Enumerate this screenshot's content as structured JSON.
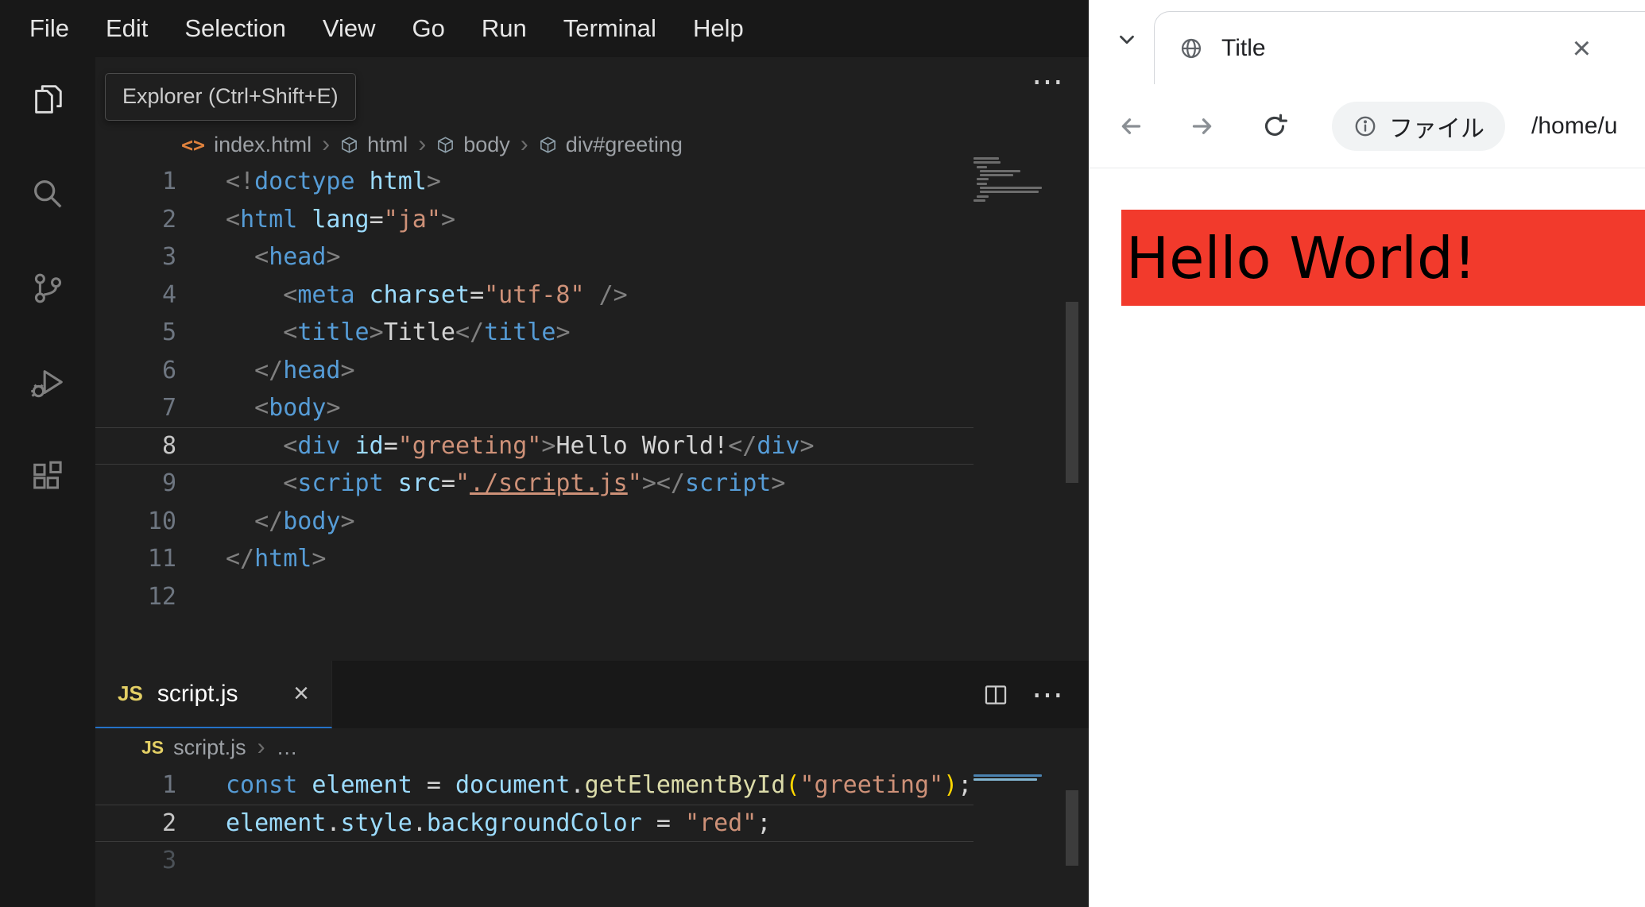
{
  "vscode": {
    "menu_items": [
      "File",
      "Edit",
      "Selection",
      "View",
      "Go",
      "Run",
      "Terminal",
      "Help"
    ],
    "activity_tooltip": "Explorer (Ctrl+Shift+E)",
    "editor_actions_more": "⋯",
    "breadcrumb": {
      "file": "index.html",
      "sep": "›",
      "segments": [
        "html",
        "body",
        "div#greeting"
      ]
    },
    "html_code": {
      "lines": [
        {
          "n": 1,
          "t": [
            [
              "pun",
              "<!"
            ],
            [
              "tag",
              "doctype"
            ],
            [
              "plain",
              " "
            ],
            [
              "attr",
              "html"
            ],
            [
              "pun",
              ">"
            ]
          ]
        },
        {
          "n": 2,
          "t": [
            [
              "pun",
              "<"
            ],
            [
              "tag",
              "html"
            ],
            [
              "plain",
              " "
            ],
            [
              "attr",
              "lang"
            ],
            [
              "plain",
              "="
            ],
            [
              "str",
              "\"ja\""
            ],
            [
              "pun",
              ">"
            ]
          ]
        },
        {
          "n": 3,
          "t": [
            [
              "plain",
              "  "
            ],
            [
              "pun",
              "<"
            ],
            [
              "tag",
              "head"
            ],
            [
              "pun",
              ">"
            ]
          ]
        },
        {
          "n": 4,
          "t": [
            [
              "plain",
              "    "
            ],
            [
              "pun",
              "<"
            ],
            [
              "tag",
              "meta"
            ],
            [
              "plain",
              " "
            ],
            [
              "attr",
              "charset"
            ],
            [
              "plain",
              "="
            ],
            [
              "str",
              "\"utf-8\""
            ],
            [
              "plain",
              " "
            ],
            [
              "pun",
              "/>"
            ]
          ]
        },
        {
          "n": 5,
          "t": [
            [
              "plain",
              "    "
            ],
            [
              "pun",
              "<"
            ],
            [
              "tag",
              "title"
            ],
            [
              "pun",
              ">"
            ],
            [
              "txt",
              "Title"
            ],
            [
              "pun",
              "</"
            ],
            [
              "tag",
              "title"
            ],
            [
              "pun",
              ">"
            ]
          ]
        },
        {
          "n": 6,
          "t": [
            [
              "plain",
              "  "
            ],
            [
              "pun",
              "</"
            ],
            [
              "tag",
              "head"
            ],
            [
              "pun",
              ">"
            ]
          ]
        },
        {
          "n": 7,
          "t": [
            [
              "plain",
              "  "
            ],
            [
              "pun",
              "<"
            ],
            [
              "tag",
              "body"
            ],
            [
              "pun",
              ">"
            ]
          ]
        },
        {
          "n": 8,
          "cur": true,
          "t": [
            [
              "plain",
              "    "
            ],
            [
              "pun",
              "<"
            ],
            [
              "tag",
              "div"
            ],
            [
              "plain",
              " "
            ],
            [
              "attr",
              "id"
            ],
            [
              "plain",
              "="
            ],
            [
              "str",
              "\"greeting\""
            ],
            [
              "pun",
              ">"
            ],
            [
              "txt",
              "Hello World!"
            ],
            [
              "pun",
              "</"
            ],
            [
              "tag",
              "div"
            ],
            [
              "pun",
              ">"
            ]
          ]
        },
        {
          "n": 9,
          "t": [
            [
              "plain",
              "    "
            ],
            [
              "pun",
              "<"
            ],
            [
              "tag",
              "script"
            ],
            [
              "plain",
              " "
            ],
            [
              "attr",
              "src"
            ],
            [
              "plain",
              "="
            ],
            [
              "str",
              "\""
            ],
            [
              "link",
              "./script.js"
            ],
            [
              "str",
              "\""
            ],
            [
              "pun",
              ">"
            ],
            [
              "pun",
              "</"
            ],
            [
              "tag",
              "script"
            ],
            [
              "pun",
              ">"
            ]
          ]
        },
        {
          "n": 10,
          "t": [
            [
              "plain",
              "  "
            ],
            [
              "pun",
              "</"
            ],
            [
              "tag",
              "body"
            ],
            [
              "pun",
              ">"
            ]
          ]
        },
        {
          "n": 11,
          "t": [
            [
              "pun",
              "</"
            ],
            [
              "tag",
              "html"
            ],
            [
              "pun",
              ">"
            ]
          ]
        },
        {
          "n": 12,
          "t": []
        }
      ]
    },
    "panel": {
      "tab_icon": "JS",
      "tab_label": "script.js",
      "close_label": "×",
      "actions_more": "⋯",
      "breadcrumb_file": "script.js",
      "breadcrumb_sep": "›",
      "breadcrumb_more": "…",
      "js_code": {
        "lines": [
          {
            "n": 1,
            "t": [
              [
                "kw",
                "const"
              ],
              [
                "plain",
                " "
              ],
              [
                "var",
                "element"
              ],
              [
                "plain",
                " = "
              ],
              [
                "var",
                "document"
              ],
              [
                "plain",
                "."
              ],
              [
                "fn",
                "getElementById"
              ],
              [
                "brk",
                "("
              ],
              [
                "str",
                "\"greeting\""
              ],
              [
                "brk",
                ")"
              ],
              [
                "plain",
                ";"
              ]
            ]
          },
          {
            "n": 2,
            "cur": true,
            "t": [
              [
                "var",
                "element"
              ],
              [
                "plain",
                "."
              ],
              [
                "var",
                "style"
              ],
              [
                "plain",
                "."
              ],
              [
                "var",
                "backgroundColor"
              ],
              [
                "plain",
                " = "
              ],
              [
                "str",
                "\"red\""
              ],
              [
                "plain",
                ";"
              ]
            ]
          },
          {
            "n": 3,
            "dim": true,
            "t": []
          }
        ]
      }
    }
  },
  "browser": {
    "tab_title": "Title",
    "close_label": "×",
    "origin_chip": "ファイル",
    "url_path": "/home/u",
    "page_heading": "Hello World!",
    "colors": {
      "heading_bg": "#f23a2c",
      "heading_text": "#000000"
    }
  }
}
